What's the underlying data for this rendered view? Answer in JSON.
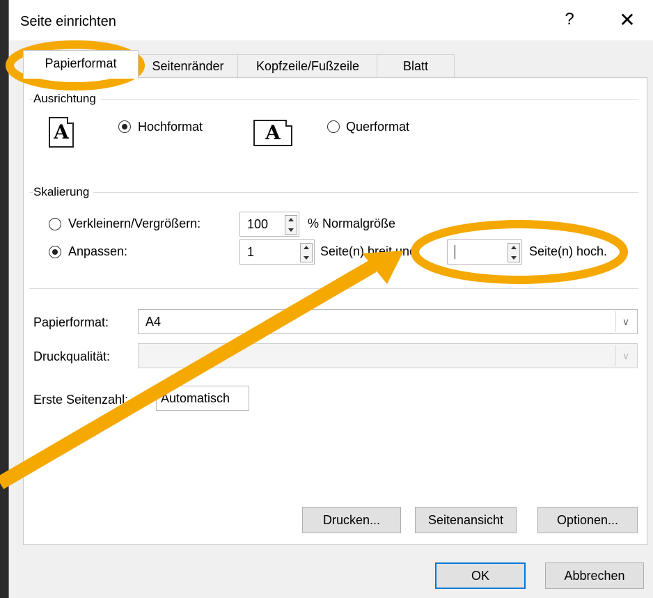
{
  "dialog": {
    "title": "Seite einrichten",
    "help_label": "?",
    "close_label": "✕"
  },
  "tabs": [
    {
      "label": "Papierformat"
    },
    {
      "label": "Seitenränder"
    },
    {
      "label": "Kopfzeile/Fußzeile"
    },
    {
      "label": "Blatt"
    }
  ],
  "orientation": {
    "group_label": "Ausrichtung",
    "portrait_label": "Hochformat",
    "landscape_label": "Querformat",
    "icon_letter": "A",
    "selected": "portrait"
  },
  "scaling": {
    "group_label": "Skalierung",
    "resize_label": "Verkleinern/Vergrößern:",
    "resize_value": "100",
    "resize_suffix": "% Normalgröße",
    "fit_label": "Anpassen:",
    "fit_wide_value": "1",
    "fit_wide_suffix": "Seite(n) breit und",
    "fit_tall_value": "",
    "fit_tall_suffix": "Seite(n) hoch.",
    "selected": "fit"
  },
  "paper": {
    "label": "Papierformat:",
    "value": "A4"
  },
  "quality": {
    "label": "Druckqualität:",
    "value": ""
  },
  "first_page": {
    "label": "Erste Seitenzahl:",
    "value": "Automatisch"
  },
  "buttons": {
    "print": "Drucken...",
    "preview": "Seitenansicht",
    "options": "Optionen...",
    "ok": "OK",
    "cancel": "Abbrechen"
  },
  "annotation": {
    "color": "#f5a800"
  }
}
